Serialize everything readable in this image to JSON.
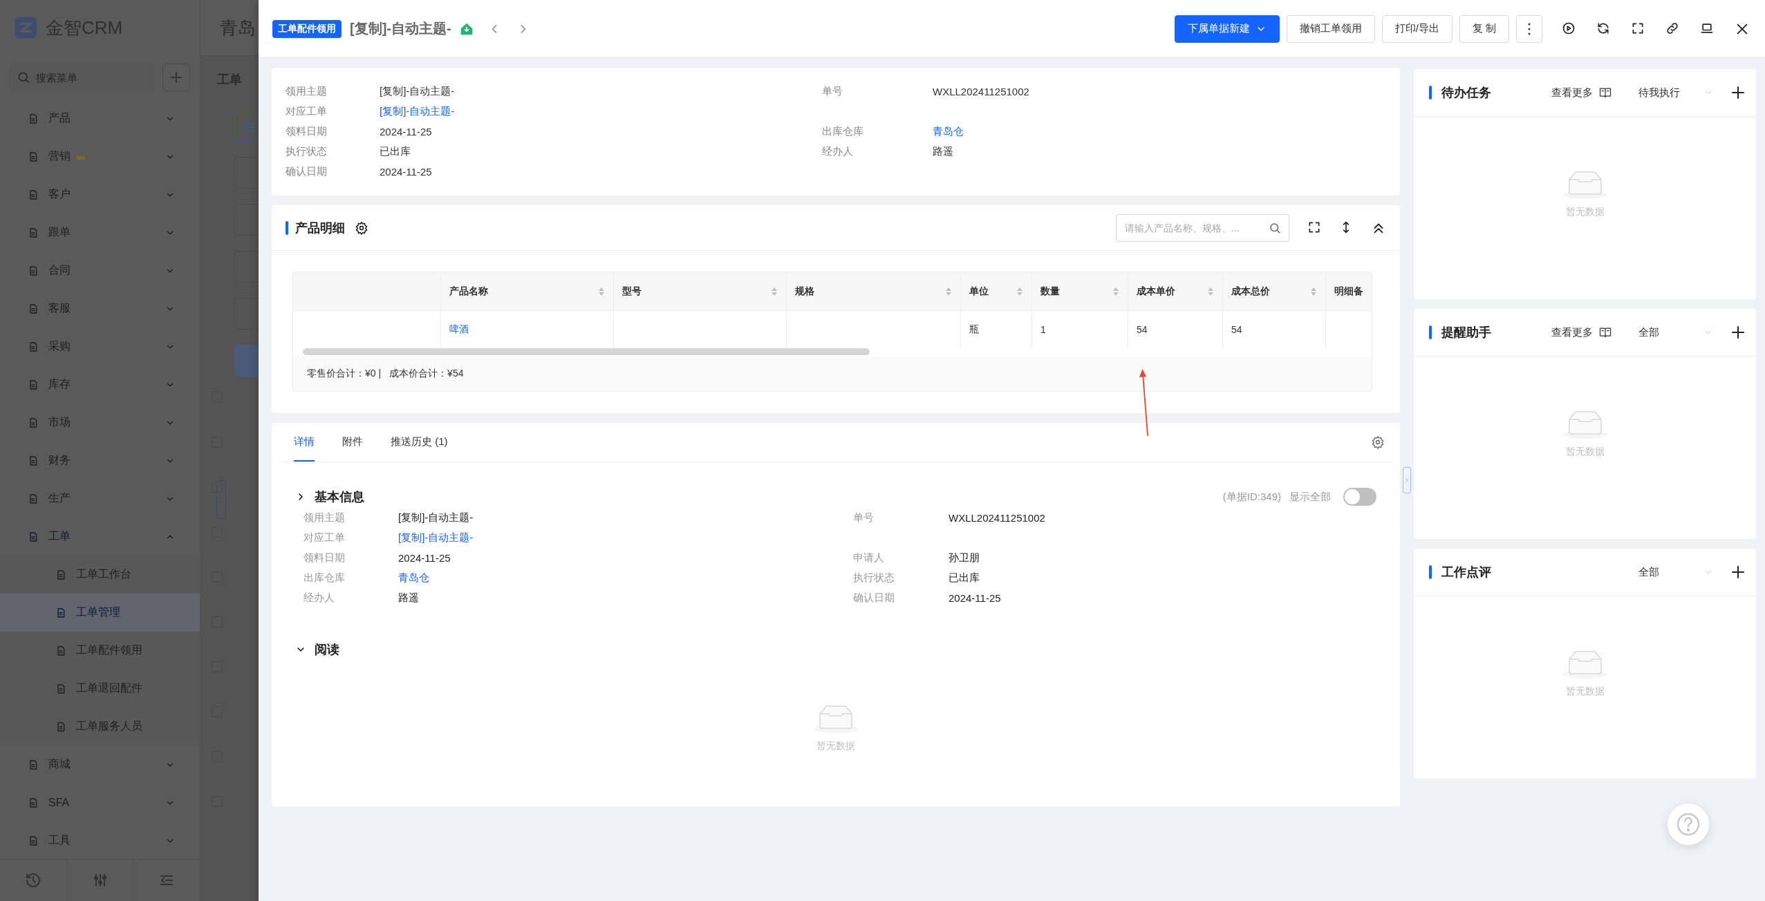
{
  "sidebar": {
    "logo": "金智CRM",
    "search": {
      "placeholder": "搜索菜单"
    },
    "menu": [
      {
        "label": "产品",
        "kind": "plain",
        "expanded": false
      },
      {
        "label": "营销",
        "kind": "promo",
        "expanded": false
      },
      {
        "label": "客户",
        "kind": "plain",
        "expanded": false
      },
      {
        "label": "跟单",
        "kind": "plain",
        "expanded": false
      },
      {
        "label": "合同",
        "kind": "plain",
        "expanded": false
      },
      {
        "label": "客服",
        "kind": "plain",
        "expanded": false
      },
      {
        "label": "采购",
        "kind": "plain",
        "expanded": false
      },
      {
        "label": "库存",
        "kind": "plain",
        "expanded": false
      },
      {
        "label": "市场",
        "kind": "plain",
        "expanded": false
      },
      {
        "label": "财务",
        "kind": "plain",
        "expanded": false
      },
      {
        "label": "生产",
        "kind": "plain",
        "expanded": false
      },
      {
        "label": "工单",
        "kind": "plain",
        "expanded": true,
        "children": [
          {
            "label": "工单工作台",
            "selected": false
          },
          {
            "label": "工单管理",
            "selected": true
          },
          {
            "label": "工单配件领用",
            "selected": false
          },
          {
            "label": "工单退回配件",
            "selected": false
          },
          {
            "label": "工单服务人员",
            "selected": false
          }
        ]
      },
      {
        "label": "商城",
        "kind": "plain",
        "expanded": false
      },
      {
        "label": "SFA",
        "kind": "plain",
        "expanded": false
      },
      {
        "label": "工具",
        "kind": "plain",
        "expanded": false
      }
    ]
  },
  "background_page": {
    "company": "青岛",
    "title": "工单",
    "checkboxes": [
      {
        "checked": false
      },
      {
        "checked": false
      },
      {
        "checked": false
      },
      {
        "checked": false
      },
      {
        "checked": false
      },
      {
        "checked": false
      },
      {
        "checked": false
      },
      {
        "checked": false
      },
      {
        "checked": false
      },
      {
        "checked": false
      }
    ]
  },
  "drawer": {
    "header": {
      "tag": "工单配件领用",
      "title": "[复制]-自动主题-",
      "actions": [
        {
          "label": "下属单据新建",
          "kind": "primary"
        },
        {
          "label": "撤销工单领用",
          "kind": "default"
        },
        {
          "label": "打印/导出",
          "kind": "default"
        },
        {
          "label": "复 制",
          "kind": "default"
        }
      ]
    },
    "summary": {
      "rows": [
        {
          "left": {
            "label": "领用主题",
            "value": "[复制]-自动主题-",
            "link": false
          },
          "right": {
            "label": "单号",
            "value": "WXLL202411251002",
            "link": false
          }
        },
        {
          "left": {
            "label": "对应工单",
            "value": "[复制]-自动主题-",
            "link": true
          }
        },
        {
          "left": {
            "label": "领料日期",
            "value": "2024-11-25",
            "link": false
          },
          "right": {
            "label": "出库仓库",
            "value": "青岛仓",
            "link": true
          }
        },
        {
          "left": {
            "label": "执行状态",
            "value": "已出库",
            "link": false
          },
          "right": {
            "label": "经办人",
            "value": "路遥",
            "link": false
          }
        },
        {
          "left": {
            "label": "确认日期",
            "value": "2024-11-25",
            "link": false
          }
        }
      ]
    },
    "products": {
      "title": "产品明细",
      "search": {
        "placeholder": "请输入产品名称、规格、..."
      },
      "table": {
        "columns": [
          "产品名称",
          "型号",
          "规格",
          "单位",
          "数量",
          "成本单价",
          "成本总价",
          "明细备"
        ],
        "rows": [
          {
            "cells": [
              {
                "text": "啤酒",
                "link": true
              },
              null,
              null,
              {
                "text": "瓶",
                "link": false
              },
              {
                "text": "1",
                "link": false
              },
              {
                "text": "54",
                "link": false
              },
              {
                "text": "54",
                "link": false
              },
              null
            ]
          }
        ]
      },
      "totals": [
        "零售价合计：¥0 |",
        "成本价合计：¥54"
      ]
    },
    "details": {
      "tabs": [
        {
          "label": "详情",
          "selected": true
        },
        {
          "label": "附件",
          "selected": false
        },
        {
          "label": "推送历史 (1)",
          "selected": false
        }
      ],
      "sections": [
        {
          "title": "基本信息",
          "expanded": false,
          "record_id": "(单据ID:349)",
          "show_all": {
            "label": "显示全部",
            "on": false
          },
          "rows": [
            {
              "left": {
                "label": "领用主题",
                "value": "[复制]-自动主题-",
                "link": false
              },
              "right": {
                "label": "单号",
                "value": "WXLL202411251002",
                "link": false
              }
            },
            {
              "left": {
                "label": "对应工单",
                "value": "[复制]-自动主题-",
                "link": true
              }
            },
            {
              "left": {
                "label": "领料日期",
                "value": "2024-11-25",
                "link": false
              },
              "right": {
                "label": "申请人",
                "value": "孙卫朋",
                "link": false
              }
            },
            {
              "left": {
                "label": "出库仓库",
                "value": "青岛仓",
                "link": true
              },
              "right": {
                "label": "执行状态",
                "value": "已出库",
                "link": false
              }
            },
            {
              "left": {
                "label": "经办人",
                "value": "路遥",
                "link": false
              },
              "right": {
                "label": "确认日期",
                "value": "2024-11-25",
                "link": false
              }
            }
          ]
        },
        {
          "title": "阅读",
          "expanded": true,
          "empty": "暂无数据"
        }
      ]
    }
  },
  "side_panels": [
    {
      "title": "待办任务",
      "more": "查看更多",
      "filter": "待我执行",
      "empty": "暂无数据"
    },
    {
      "title": "提醒助手",
      "more": "查看更多",
      "filter": "全部",
      "empty": "暂无数据"
    },
    {
      "title": "工作点评",
      "filter": "全部",
      "empty": "暂无数据"
    }
  ]
}
